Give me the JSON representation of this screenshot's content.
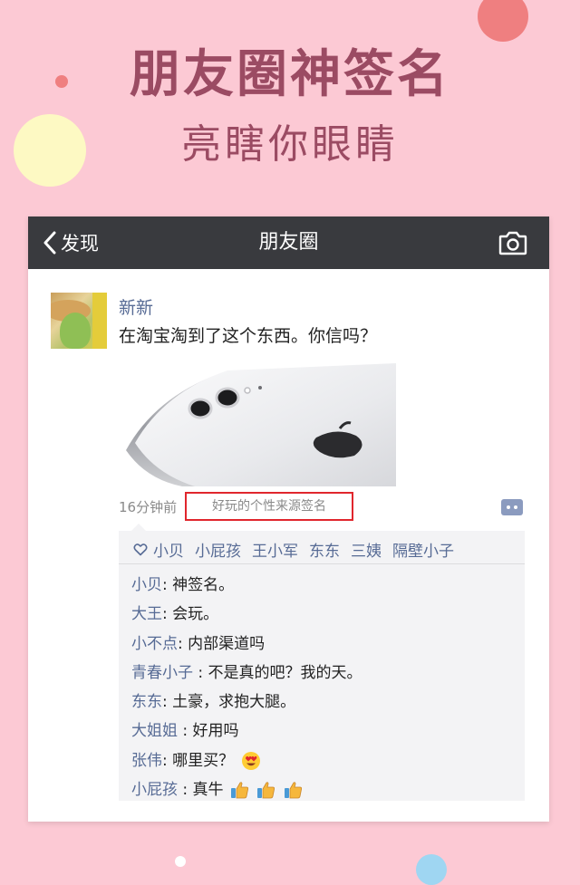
{
  "promo": {
    "headline": "朋友圈神签名",
    "subline": "亮瞎你眼睛"
  },
  "navbar": {
    "back_label": "发现",
    "title": "朋友圈",
    "camera_icon": "camera-icon"
  },
  "post": {
    "author": "新新",
    "text": "在淘宝淘到了这个东西。你信吗？",
    "time": "16分钟前",
    "source": "好玩的个性来源签名"
  },
  "likes": [
    "小贝",
    "小屁孩",
    "王小军",
    "东东",
    "三姨",
    "隔壁小子"
  ],
  "comments": [
    {
      "author": "小贝",
      "sep": ": ",
      "text": "神签名。",
      "emoji_count": 0,
      "emoji": ""
    },
    {
      "author": "大王",
      "sep": ": ",
      "text": "会玩。",
      "emoji_count": 0,
      "emoji": ""
    },
    {
      "author": "小不点",
      "sep": ": ",
      "text": "内部渠道吗",
      "emoji_count": 0,
      "emoji": ""
    },
    {
      "author": "青春小子",
      "sep": " : ",
      "text": "不是真的吧？我的天。",
      "emoji_count": 0,
      "emoji": ""
    },
    {
      "author": "东东",
      "sep": ": ",
      "text": "土豪，求抱大腿。",
      "emoji_count": 0,
      "emoji": ""
    },
    {
      "author": "大姐姐",
      "sep": " : ",
      "text": "好用吗",
      "emoji_count": 0,
      "emoji": ""
    },
    {
      "author": "张伟",
      "sep": ": ",
      "text": "哪里买？",
      "emoji_count": 1,
      "emoji": "heart-eyes-emoji"
    },
    {
      "author": "小屁孩",
      "sep": " : ",
      "text": "真牛",
      "emoji_count": 3,
      "emoji": "thumbs-up-emoji"
    }
  ],
  "colors": {
    "background": "#fcc9d4",
    "headline": "#9b4b63",
    "navbar": "#393a3e",
    "link": "#576b95",
    "highlight_border": "#e0262d"
  }
}
